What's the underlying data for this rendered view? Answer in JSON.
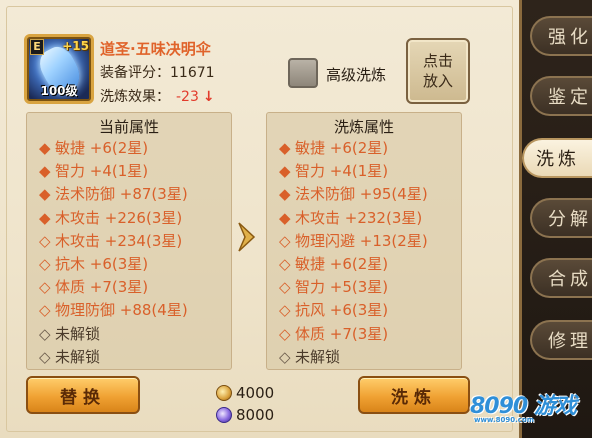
{
  "item": {
    "grade": "E",
    "plus": "+15",
    "level": "100级",
    "name": "道圣·五味决明伞",
    "rating_label": "装备评分：",
    "rating_value": "11671",
    "effect_label": "洗炼效果：",
    "effect_value": "-23",
    "effect_arrow": "↓"
  },
  "advanced": {
    "label": "高级洗炼",
    "checked": false
  },
  "place_button": "点击放入",
  "current": {
    "title": "当前属性",
    "attributes": [
      {
        "bullet": "◆",
        "text": "敏捷  +6(2星)",
        "kind": "filled"
      },
      {
        "bullet": "◆",
        "text": "智力  +4(1星)",
        "kind": "filled"
      },
      {
        "bullet": "◆",
        "text": "法术防御  +87(3星)",
        "kind": "filled"
      },
      {
        "bullet": "◆",
        "text": "木攻击  +226(3星)",
        "kind": "filled"
      },
      {
        "bullet": "◇",
        "text": "木攻击  +234(3星)",
        "kind": "hollow"
      },
      {
        "bullet": "◇",
        "text": "抗木  +6(3星)",
        "kind": "hollow"
      },
      {
        "bullet": "◇",
        "text": "体质  +7(3星)",
        "kind": "hollow"
      },
      {
        "bullet": "◇",
        "text": "物理防御  +88(4星)",
        "kind": "hollow"
      },
      {
        "bullet": "◇",
        "text": "未解锁",
        "kind": "locked"
      },
      {
        "bullet": "◇",
        "text": "未解锁",
        "kind": "locked"
      }
    ]
  },
  "refined": {
    "title": "洗炼属性",
    "attributes": [
      {
        "bullet": "◆",
        "text": "敏捷  +6(2星)",
        "kind": "filled"
      },
      {
        "bullet": "◆",
        "text": "智力  +4(1星)",
        "kind": "filled"
      },
      {
        "bullet": "◆",
        "text": "法术防御  +95(4星)",
        "kind": "filled"
      },
      {
        "bullet": "◆",
        "text": "木攻击  +232(3星)",
        "kind": "filled"
      },
      {
        "bullet": "◇",
        "text": "物理闪避  +13(2星)",
        "kind": "hollow"
      },
      {
        "bullet": "◇",
        "text": "敏捷  +6(2星)",
        "kind": "hollow"
      },
      {
        "bullet": "◇",
        "text": "智力  +5(3星)",
        "kind": "hollow"
      },
      {
        "bullet": "◇",
        "text": "抗风  +6(3星)",
        "kind": "hollow"
      },
      {
        "bullet": "◇",
        "text": "体质  +7(3星)",
        "kind": "hollow"
      },
      {
        "bullet": "◇",
        "text": "未解锁",
        "kind": "locked"
      }
    ]
  },
  "buttons": {
    "replace": "替换",
    "wash": "洗炼"
  },
  "costs": {
    "gold": "4000",
    "orb": "8000"
  },
  "tabs": [
    {
      "label": "强化",
      "active": false
    },
    {
      "label": "鉴定",
      "active": false
    },
    {
      "label": "洗炼",
      "active": true
    },
    {
      "label": "分解",
      "active": false
    },
    {
      "label": "合成",
      "active": false
    },
    {
      "label": "修理",
      "active": false
    }
  ],
  "watermark": {
    "main": "8090 游戏",
    "sub": "www.8090.com"
  },
  "colors": {
    "accent_orange": "#d9602a",
    "negative_red": "#e23c2c",
    "button_gold": "#f0a233"
  }
}
